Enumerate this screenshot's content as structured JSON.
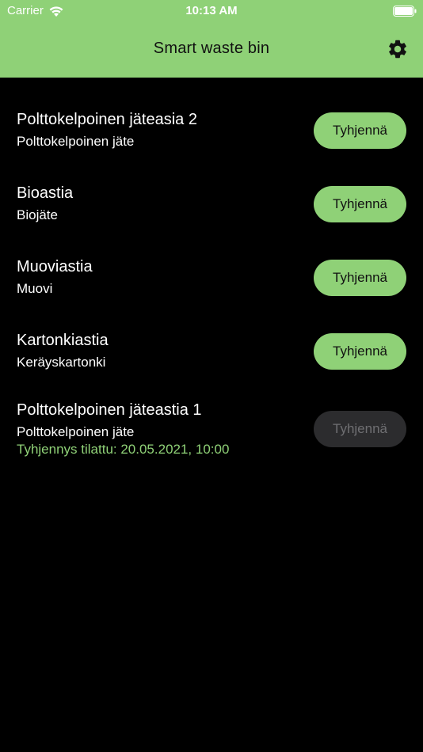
{
  "status_bar": {
    "carrier": "Carrier",
    "time": "10:13 AM"
  },
  "header": {
    "title": "Smart waste bin",
    "settings_icon": "gear-icon"
  },
  "colors": {
    "accent": "#8fd177",
    "background": "#000000",
    "disabled_button": "#2c2c2e"
  },
  "bins": [
    {
      "name": "Polttokelpoinen jäteasia 2",
      "type": "Polttokelpoinen jäte",
      "button_label": "Tyhjennä",
      "button_enabled": true
    },
    {
      "name": "Bioastia",
      "type": "Biojäte",
      "button_label": "Tyhjennä",
      "button_enabled": true
    },
    {
      "name": "Muoviastia",
      "type": "Muovi",
      "button_label": "Tyhjennä",
      "button_enabled": true
    },
    {
      "name": "Kartonkiastia",
      "type": "Keräyskartonki",
      "button_label": "Tyhjennä",
      "button_enabled": true
    },
    {
      "name": "Polttokelpoinen jäteastia 1",
      "type": "Polttokelpoinen jäte",
      "order_status": "Tyhjennys tilattu: 20.05.2021, 10:00",
      "button_label": "Tyhjennä",
      "button_enabled": false
    }
  ]
}
